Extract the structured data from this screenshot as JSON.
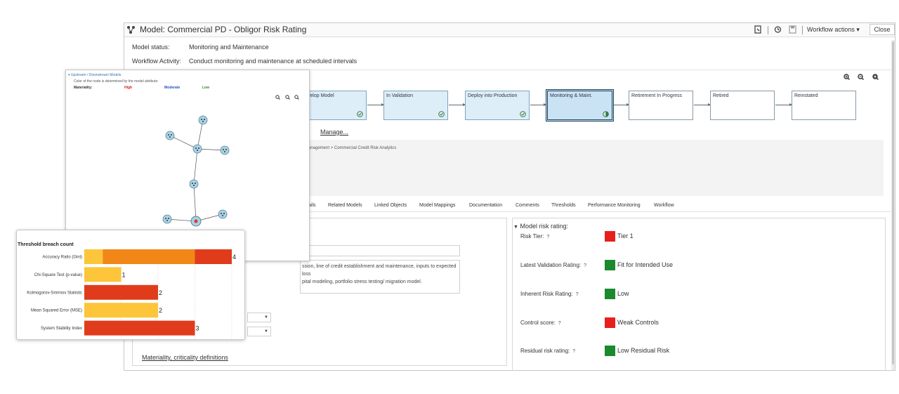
{
  "window": {
    "title": "Model: Commercial PD - Obligor Risk Rating",
    "workflow_actions_label": "Workflow actions",
    "close_label": "Close"
  },
  "info": {
    "status_label": "Model status:",
    "status_value": "Monitoring and Maintenance",
    "activity_label": "Workflow Activity:",
    "activity_value": "Conduct monitoring and maintenance at scheduled intervals"
  },
  "workflow": {
    "steps": [
      {
        "label": "evelop Model",
        "state": "done"
      },
      {
        "label": "In Validation",
        "state": "done"
      },
      {
        "label": "Deploy into Production",
        "state": "done"
      },
      {
        "label": "Monitoring & Maint.",
        "state": "current"
      },
      {
        "label": "Retirement In Progress",
        "state": "pending"
      },
      {
        "label": "Retired",
        "state": "pending"
      },
      {
        "label": "Reinstated",
        "state": "pending"
      }
    ],
    "manage_label": "Manage..."
  },
  "details": {
    "breadcrumb": "anagement > Commercial Credit Risk Analytics",
    "paren": ")"
  },
  "tabs": [
    "ails",
    "Related Models",
    "Linked Objects",
    "Model Mappings",
    "Documentation",
    "Comments",
    "Thresholds",
    "Performance Monitoring",
    "Workflow"
  ],
  "left_panel": {
    "description_line1": "ssion, line of credit establishment and maintenance, inputs to expected loss",
    "description_line2": "pital modeling, portfolio stress testing/ migration model.",
    "materiality_link": "Materiality, criticality definitions"
  },
  "risk": {
    "section_title": "Model risk rating:",
    "items": [
      {
        "label": "Risk Tier:",
        "value": "Tier 1",
        "color": "#e8201d"
      },
      {
        "label": "Latest Validation Rating:",
        "value": "Fit for Intended Use",
        "color": "#1b8a2c"
      },
      {
        "label": "Inherent Risk Rating:",
        "value": "Low",
        "color": "#1b8a2c"
      },
      {
        "label": "Control score:",
        "value": "Weak Controls",
        "color": "#e8201d"
      },
      {
        "label": "Residual risk rating:",
        "value": "Low Residual Risk",
        "color": "#1b8a2c"
      }
    ]
  },
  "network": {
    "header": "Upstream / Downstream Models",
    "caption": "Color of the node is determined by the model attribute:",
    "legend_label": "Materiality:",
    "legend": [
      {
        "label": "High",
        "color": "#d62020"
      },
      {
        "label": "Moderate",
        "color": "#2a4db8"
      },
      {
        "label": "Low",
        "color": "#2e8a2e"
      }
    ]
  },
  "chart_data": {
    "type": "bar",
    "orientation": "horizontal",
    "stacked": true,
    "title": "Threshold breach count",
    "categories": [
      "Accuracy Ratio (Gini)",
      "Chi-Square Test (p-value)",
      "Kolmogorov-Smirnov Statistic",
      "Mean Squared Error (MSE)",
      "System Stability Index"
    ],
    "totals": [
      4,
      1,
      2,
      2,
      3
    ],
    "segments": [
      [
        {
          "value": 0.5,
          "color": "#fcc53a"
        },
        {
          "value": 2.5,
          "color": "#f08717"
        },
        {
          "value": 1,
          "color": "#e03c1c"
        }
      ],
      [
        {
          "value": 1,
          "color": "#fcc53a"
        }
      ],
      [
        {
          "value": 2,
          "color": "#e03c1c"
        }
      ],
      [
        {
          "value": 2,
          "color": "#fcc53a"
        }
      ],
      [
        {
          "value": 3,
          "color": "#e03c1c"
        }
      ]
    ],
    "xlim": [
      0,
      4
    ],
    "grid": true
  }
}
